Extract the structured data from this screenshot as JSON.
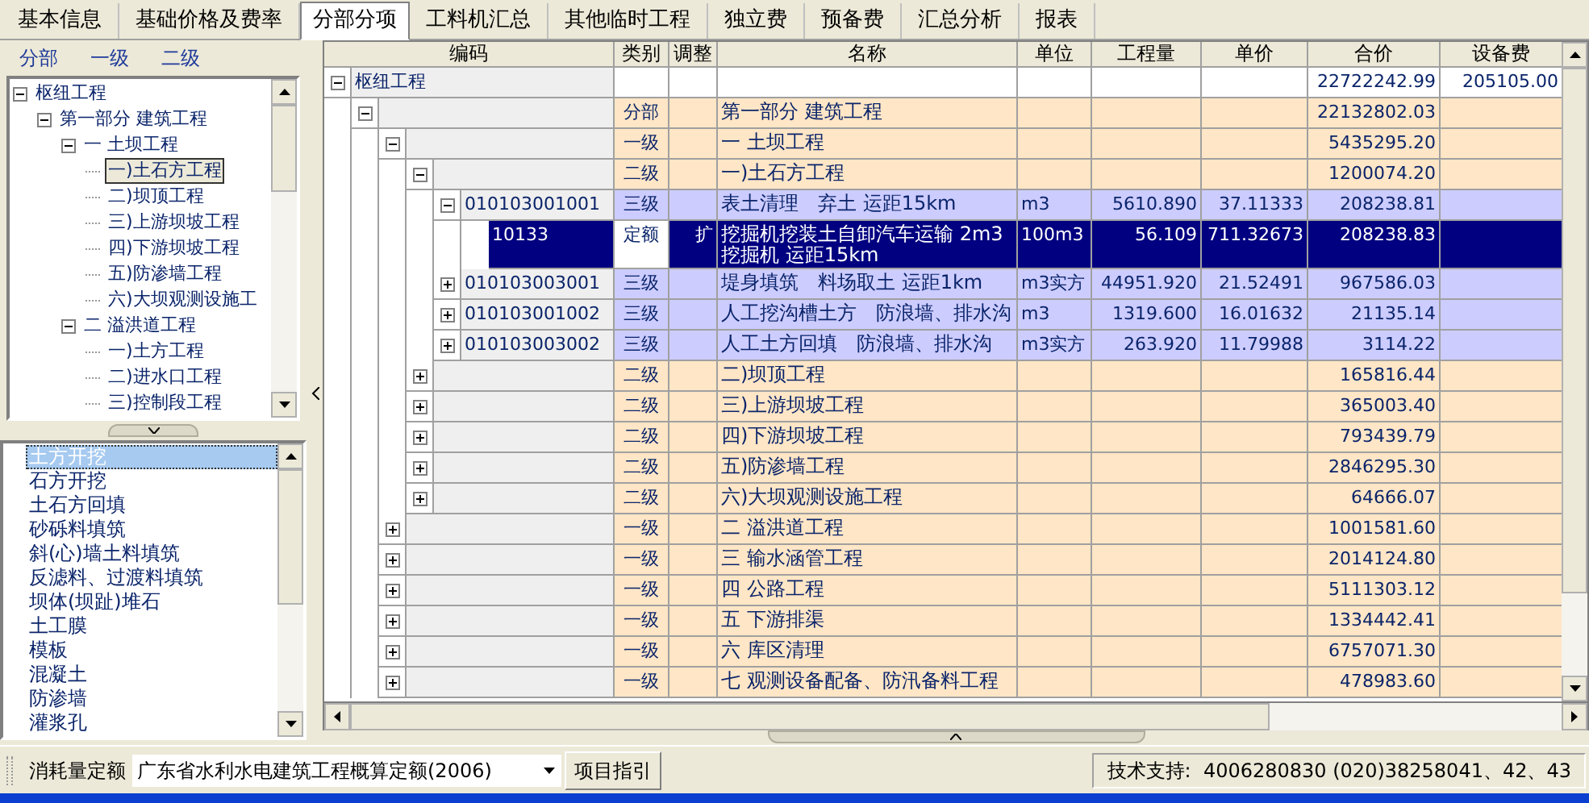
{
  "tabs": [
    {
      "label": "基本信息",
      "selected": false
    },
    {
      "label": "基础价格及费率",
      "selected": false
    },
    {
      "label": "分部分项",
      "selected": true
    },
    {
      "label": "工料机汇总",
      "selected": false
    },
    {
      "label": "其他临时工程",
      "selected": false
    },
    {
      "label": "独立费",
      "selected": false
    },
    {
      "label": "预备费",
      "selected": false
    },
    {
      "label": "汇总分析",
      "selected": false
    },
    {
      "label": "报表",
      "selected": false
    }
  ],
  "level_links": [
    "分部",
    "一级",
    "二级"
  ],
  "section_tree": [
    {
      "label": "枢纽工程",
      "expanded": true,
      "selected": false,
      "children": [
        {
          "label": "第一部分 建筑工程",
          "expanded": true,
          "selected": false,
          "children": [
            {
              "label": "一 土坝工程",
              "expanded": true,
              "selected": false,
              "children": [
                {
                  "label": "一)土石方工程",
                  "selected": true
                },
                {
                  "label": "二)坝顶工程",
                  "selected": false
                },
                {
                  "label": "三)上游坝坡工程",
                  "selected": false
                },
                {
                  "label": "四)下游坝坡工程",
                  "selected": false
                },
                {
                  "label": "五)防渗墙工程",
                  "selected": false
                },
                {
                  "label": "六)大坝观测设施工",
                  "selected": false
                }
              ]
            },
            {
              "label": "二 溢洪道工程",
              "expanded": true,
              "selected": false,
              "children": [
                {
                  "label": "一)土方工程",
                  "selected": false
                },
                {
                  "label": "二)进水口工程",
                  "selected": false
                },
                {
                  "label": "三)控制段工程",
                  "selected": false
                }
              ]
            }
          ]
        }
      ]
    }
  ],
  "guide_list": [
    {
      "label": "土方开挖",
      "selected": true
    },
    {
      "label": "石方开挖",
      "selected": false
    },
    {
      "label": "土石方回填",
      "selected": false
    },
    {
      "label": "砂砾料填筑",
      "selected": false
    },
    {
      "label": "斜(心)墙土料填筑",
      "selected": false
    },
    {
      "label": "反滤料、过渡料填筑",
      "selected": false
    },
    {
      "label": "坝体(坝趾)堆石",
      "selected": false
    },
    {
      "label": "土工膜",
      "selected": false
    },
    {
      "label": "模板",
      "selected": false
    },
    {
      "label": "混凝土",
      "selected": false
    },
    {
      "label": "防渗墙",
      "selected": false
    },
    {
      "label": "灌浆孔",
      "selected": false
    }
  ],
  "table": {
    "columns": [
      "编码",
      "类别",
      "调整",
      "名称",
      "单位",
      "工程量",
      "单价",
      "合价",
      "设备费"
    ],
    "rows": [
      {
        "kind": "root",
        "code": "枢纽工程",
        "expanded": true,
        "selected": false,
        "total": "22722242.99",
        "equipment": "205105.00",
        "children": [
          {
            "kind": "section",
            "category": "分部",
            "name": "第一部分 建筑工程",
            "total": "22132802.03",
            "expanded": true,
            "selected": false,
            "children": [
              {
                "kind": "section",
                "category": "一级",
                "name": "一 土坝工程",
                "total": "5435295.20",
                "expanded": true,
                "selected": false,
                "children": [
                  {
                    "kind": "section",
                    "category": "二级",
                    "name": "一)土石方工程",
                    "total": "1200074.20",
                    "expanded": true,
                    "selected": false,
                    "children": [
                      {
                        "kind": "item",
                        "code": "010103001001",
                        "category": "三级",
                        "name": "表土清理　弃土 运距15km",
                        "unit": "m3",
                        "quantity": "5610.890",
                        "price": "37.11333",
                        "total": "208238.81",
                        "expanded": true,
                        "selected": false,
                        "children": [
                          {
                            "kind": "norm",
                            "code": "10133",
                            "category": "定额",
                            "adjust": "扩",
                            "name": "挖掘机挖装土自卸汽车运输 2m3挖掘机 运距15km",
                            "unit": "100m3",
                            "quantity": "56.109",
                            "price": "711.32673",
                            "total": "208238.83",
                            "selected": true
                          }
                        ]
                      },
                      {
                        "kind": "item",
                        "code": "010103003001",
                        "category": "三级",
                        "name": "堤身填筑　料场取土 运距1km",
                        "unit": "m3实方",
                        "quantity": "44951.920",
                        "price": "21.52491",
                        "total": "967586.03",
                        "expanded": false,
                        "selected": false
                      },
                      {
                        "kind": "item",
                        "code": "010103001002",
                        "category": "三级",
                        "name": "人工挖沟槽土方　防浪墙、排水沟",
                        "unit": "m3",
                        "quantity": "1319.600",
                        "price": "16.01632",
                        "total": "21135.14",
                        "expanded": false,
                        "selected": false
                      },
                      {
                        "kind": "item",
                        "code": "010103003002",
                        "category": "三级",
                        "name": "人工土方回填　防浪墙、排水沟",
                        "unit": "m3实方",
                        "quantity": "263.920",
                        "price": "11.79988",
                        "total": "3114.22",
                        "expanded": false,
                        "selected": false
                      }
                    ]
                  },
                  {
                    "kind": "section",
                    "category": "二级",
                    "name": "二)坝顶工程",
                    "total": "165816.44",
                    "expanded": false,
                    "selected": false
                  },
                  {
                    "kind": "section",
                    "category": "二级",
                    "name": "三)上游坝坡工程",
                    "total": "365003.40",
                    "expanded": false,
                    "selected": false
                  },
                  {
                    "kind": "section",
                    "category": "二级",
                    "name": "四)下游坝坡工程",
                    "total": "793439.79",
                    "expanded": false,
                    "selected": false
                  },
                  {
                    "kind": "section",
                    "category": "二级",
                    "name": "五)防渗墙工程",
                    "total": "2846295.30",
                    "expanded": false,
                    "selected": false
                  },
                  {
                    "kind": "section",
                    "category": "二级",
                    "name": "六)大坝观测设施工程",
                    "total": "64666.07",
                    "expanded": false,
                    "selected": false
                  }
                ]
              },
              {
                "kind": "section",
                "category": "一级",
                "name": "二 溢洪道工程",
                "total": "1001581.60",
                "expanded": false,
                "selected": false
              },
              {
                "kind": "section",
                "category": "一级",
                "name": "三 输水涵管工程",
                "total": "2014124.80",
                "expanded": false,
                "selected": false
              },
              {
                "kind": "section",
                "category": "一级",
                "name": "四 公路工程",
                "total": "5111303.12",
                "expanded": false,
                "selected": false
              },
              {
                "kind": "section",
                "category": "一级",
                "name": "五 下游排渠",
                "total": "1334442.41",
                "expanded": false,
                "selected": false
              },
              {
                "kind": "section",
                "category": "一级",
                "name": "六 库区清理",
                "total": "6757071.30",
                "expanded": false,
                "selected": false
              },
              {
                "kind": "section",
                "category": "一级",
                "name": "七 观测设备配备、防汛备料工程",
                "total": "478983.60",
                "expanded": false,
                "selected": false
              }
            ]
          }
        ]
      }
    ]
  },
  "bottom_bar": {
    "quota_label": "消耗量定额",
    "quota_value": "广东省水利水电建筑工程概算定额(2006)",
    "guide_button": "项目指引",
    "support": "技术支持:  4006280830 (020)38258041、42、43"
  }
}
